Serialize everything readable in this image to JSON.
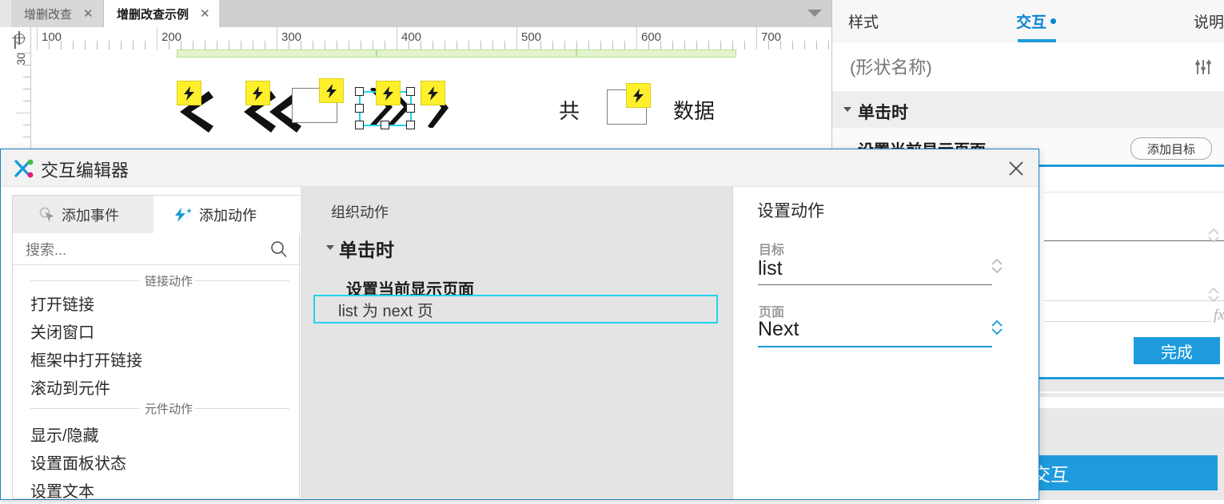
{
  "tabbar": {
    "tabs": [
      {
        "label": "增删改查",
        "close": "✕",
        "active": false
      },
      {
        "label": "增删改查示例",
        "close": "✕",
        "active": true
      }
    ],
    "overflow_icon": "chevron-down-icon"
  },
  "ruler": {
    "h_ticks": [
      "100",
      "200",
      "300",
      "400",
      "500",
      "600",
      "700"
    ],
    "v_ticks": [
      "30"
    ],
    "origin_icon": "origin-crosshair-icon"
  },
  "canvas": {
    "texts": [
      {
        "value": "共"
      },
      {
        "value": "数据"
      }
    ],
    "badge_icon": "lightning-bolt-icon",
    "badge_color": "#fff02b",
    "selection_color": "#22d3ee",
    "guide_color": "#e2f4cd"
  },
  "inspector": {
    "tabs": [
      {
        "label": "样式",
        "active": false
      },
      {
        "label": "交互",
        "active": true,
        "dot": true
      },
      {
        "label": "说明",
        "active": false
      }
    ],
    "shape_name_placeholder": "(形状名称)",
    "shape_name_value": "",
    "sliders_icon": "sliders-icon",
    "event_title": "单击时",
    "event_action": "设置当前显示页面",
    "add_target_label": "添加目标",
    "done_label": "完成",
    "new_interaction_label": "交互",
    "fx_label": "fx",
    "accent_color": "#1d9bdd"
  },
  "dialog": {
    "title": "交互编辑器",
    "close_icon": "close-icon",
    "logo_icon": "axure-x-logo-icon",
    "left": {
      "tabs": [
        {
          "label": "添加事件",
          "icon": "cursor-click-icon",
          "active": false
        },
        {
          "label": "添加动作",
          "icon": "lightning-plus-icon",
          "active": true
        }
      ],
      "search_placeholder": "搜索...",
      "search_value": "",
      "search_icon": "search-icon",
      "groups": [
        {
          "label": "链接动作",
          "items": [
            "打开链接",
            "关闭窗口",
            "框架中打开链接",
            "滚动到元件"
          ]
        },
        {
          "label": "元件动作",
          "items": [
            "显示/隐藏",
            "设置面板状态",
            "设置文本"
          ]
        }
      ]
    },
    "middle": {
      "title": "组织动作",
      "event": "单击时",
      "action_group": "设置当前显示页面",
      "selected_action": "list 为 next 页"
    },
    "right": {
      "title": "设置动作",
      "target_label": "目标",
      "target_value": "list",
      "page_label": "页面",
      "page_value": "Next",
      "stepper_icon": "stepper-updown-icon"
    }
  }
}
